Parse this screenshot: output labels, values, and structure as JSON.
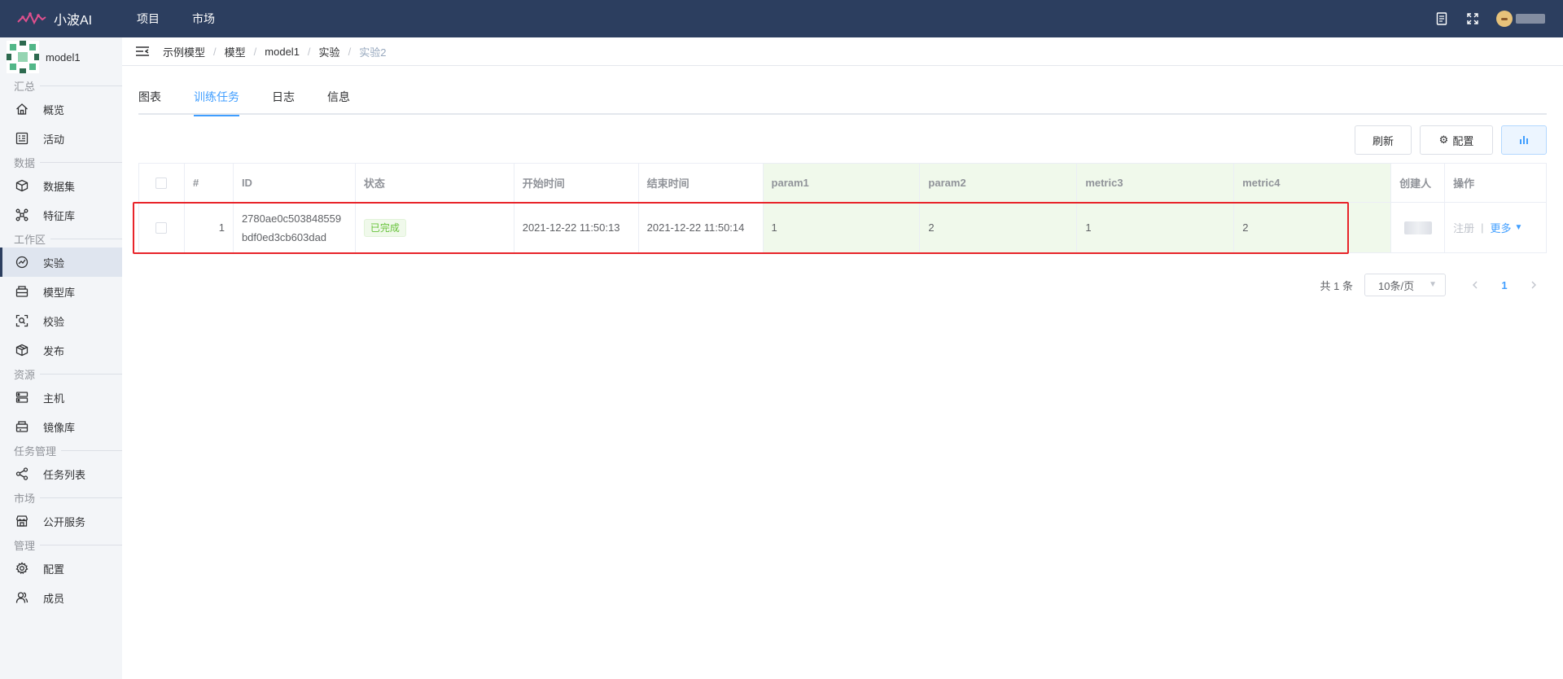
{
  "app": {
    "name": "小波AI",
    "nav": [
      "项目",
      "市场"
    ]
  },
  "sidebar": {
    "model_name": "model1",
    "groups": [
      {
        "title": "汇总",
        "items": [
          {
            "label": "概览",
            "icon": "home-icon"
          },
          {
            "label": "活动",
            "icon": "activity-icon"
          }
        ]
      },
      {
        "title": "数据",
        "items": [
          {
            "label": "数据集",
            "icon": "dataset-icon"
          },
          {
            "label": "特征库",
            "icon": "feature-store-icon"
          }
        ]
      },
      {
        "title": "工作区",
        "items": [
          {
            "label": "实验",
            "icon": "experiment-icon",
            "active": true
          },
          {
            "label": "模型库",
            "icon": "model-store-icon"
          },
          {
            "label": "校验",
            "icon": "validate-icon"
          },
          {
            "label": "发布",
            "icon": "publish-icon"
          }
        ]
      },
      {
        "title": "资源",
        "items": [
          {
            "label": "主机",
            "icon": "server-icon"
          },
          {
            "label": "镜像库",
            "icon": "image-store-icon"
          }
        ]
      },
      {
        "title": "任务管理",
        "items": [
          {
            "label": "任务列表",
            "icon": "task-list-icon"
          }
        ]
      },
      {
        "title": "市场",
        "items": [
          {
            "label": "公开服务",
            "icon": "public-service-icon"
          }
        ]
      },
      {
        "title": "管理",
        "items": [
          {
            "label": "配置",
            "icon": "settings-icon"
          },
          {
            "label": "成员",
            "icon": "members-icon"
          }
        ]
      }
    ]
  },
  "breadcrumb": [
    "示例模型",
    "模型",
    "model1",
    "实验",
    "实验2"
  ],
  "tabs": [
    {
      "label": "图表",
      "active": false
    },
    {
      "label": "训练任务",
      "active": true
    },
    {
      "label": "日志",
      "active": false
    },
    {
      "label": "信息",
      "active": false
    }
  ],
  "toolbar": {
    "refresh_label": "刷新",
    "config_label": "配置",
    "chart_icon": "bar-chart-icon"
  },
  "table": {
    "columns": [
      "#",
      "ID",
      "状态",
      "开始时间",
      "结束时间",
      "param1",
      "param2",
      "metric3",
      "metric4",
      "创建人",
      "操作"
    ],
    "rows": [
      {
        "index": "1",
        "id_line1": "2780ae0c503848559",
        "id_line2": "bdf0ed3cb603dad",
        "status": "已完成",
        "start": "2021-12-22 11:50:13",
        "end": "2021-12-22 11:50:14",
        "param1": "1",
        "param2": "2",
        "metric3": "1",
        "metric4": "2",
        "op_register": "注册",
        "op_more": "更多"
      }
    ]
  },
  "pagination": {
    "total": "共 1 条",
    "page_size": "10条/页",
    "current": "1"
  },
  "colors": {
    "topbar": "#2c3e5f",
    "accent": "#409eff",
    "success": "#67c23a",
    "param_bg": "#f0f9eb",
    "highlight": "#e8242a"
  }
}
